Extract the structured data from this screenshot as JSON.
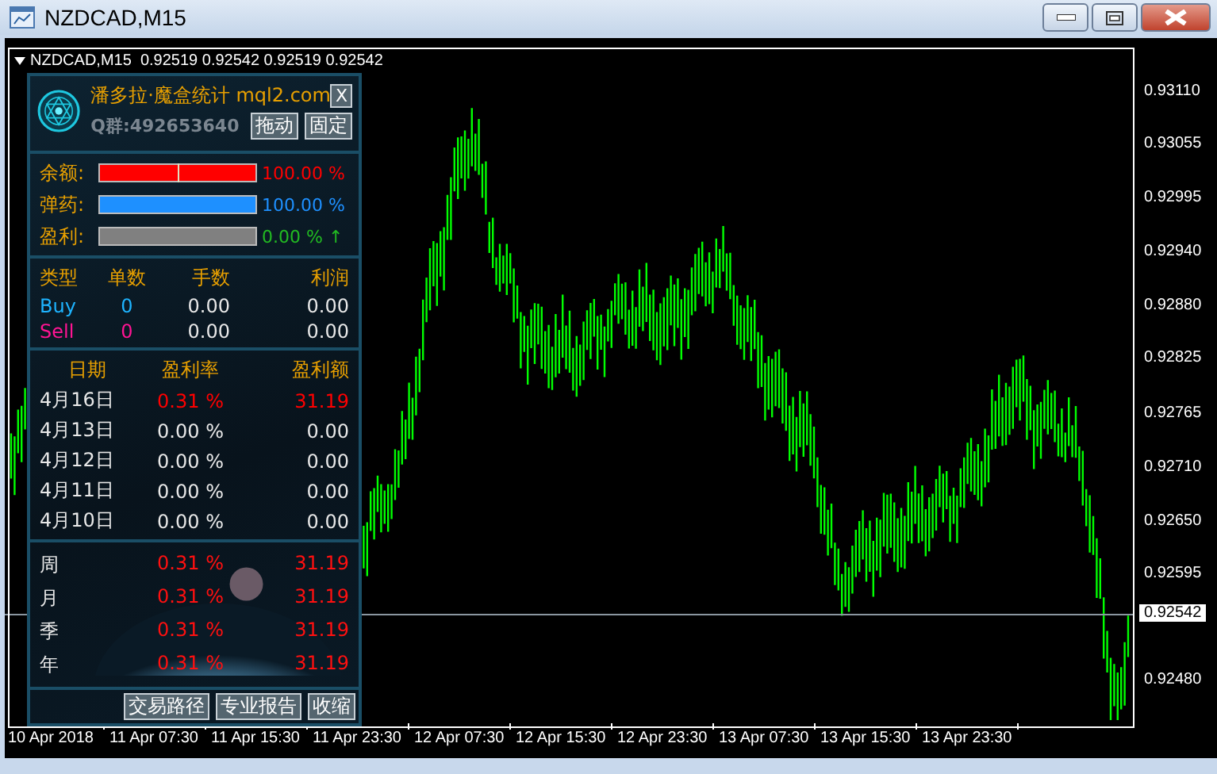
{
  "window": {
    "title": "NZDCAD,M15"
  },
  "chart": {
    "header": "NZDCAD,M15  0.92519 0.92542 0.92519 0.92542",
    "price_labels": [
      "0.93110",
      "0.93055",
      "0.92995",
      "0.92940",
      "0.92880",
      "0.92825",
      "0.92765",
      "0.92710",
      "0.92650",
      "0.92595",
      "0.92480"
    ],
    "current_price": "0.92542",
    "time_labels": [
      "10 Apr 2018",
      "11 Apr 07:30",
      "11 Apr 15:30",
      "11 Apr 23:30",
      "12 Apr 07:30",
      "12 Apr 15:30",
      "12 Apr 23:30",
      "13 Apr 07:30",
      "13 Apr 15:30",
      "13 Apr 23:30"
    ]
  },
  "panel": {
    "title": "潘多拉·魔盒统计 mql2.com",
    "close": "X",
    "group": "Q群:492653640",
    "buttons": [
      "拖动",
      "固定"
    ],
    "meters": [
      {
        "label": "余额:",
        "level": 1,
        "reading": "100.00 %",
        "color": "#ff0000",
        "marker": true
      },
      {
        "label": "弹药:",
        "level": 1,
        "reading": "100.00 %",
        "color": "#1e90ff",
        "marker": false
      },
      {
        "label": "盈利:",
        "level": 0,
        "reading": "0.00 % ↑",
        "color": "#22bb22",
        "marker": false
      }
    ],
    "orders": {
      "columns": [
        "类型",
        "单数",
        "手数",
        "利润"
      ],
      "rows": [
        {
          "type": "Buy",
          "count": "0",
          "lots": "0.00",
          "profit": "0.00",
          "color": "#1eb4ff"
        },
        {
          "type": "Sell",
          "count": "0",
          "lots": "0.00",
          "profit": "0.00",
          "color": "#ff1493"
        }
      ]
    },
    "daily": {
      "columns": [
        "日期",
        "盈利率",
        "盈利额"
      ],
      "rows": [
        {
          "date": "4月16日",
          "rate": "0.31 %",
          "amount": "31.19",
          "color": "#ff0000"
        },
        {
          "date": "4月13日",
          "rate": "0.00 %",
          "amount": "0.00",
          "color": "#e8e8e8"
        },
        {
          "date": "4月12日",
          "rate": "0.00 %",
          "amount": "0.00",
          "color": "#e8e8e8"
        },
        {
          "date": "4月11日",
          "rate": "0.00 %",
          "amount": "0.00",
          "color": "#e8e8e8"
        },
        {
          "date": "4月10日",
          "rate": "0.00 %",
          "amount": "0.00",
          "color": "#e8e8e8"
        }
      ]
    },
    "periods": [
      {
        "label": "周",
        "rate": "0.31 %",
        "amount": "31.19"
      },
      {
        "label": "月",
        "rate": "0.31 %",
        "amount": "31.19"
      },
      {
        "label": "季",
        "rate": "0.31 %",
        "amount": "31.19"
      },
      {
        "label": "年",
        "rate": "0.31 %",
        "amount": "31.19"
      }
    ],
    "footer_buttons": [
      "交易路径",
      "专业报告",
      "收缩"
    ]
  }
}
